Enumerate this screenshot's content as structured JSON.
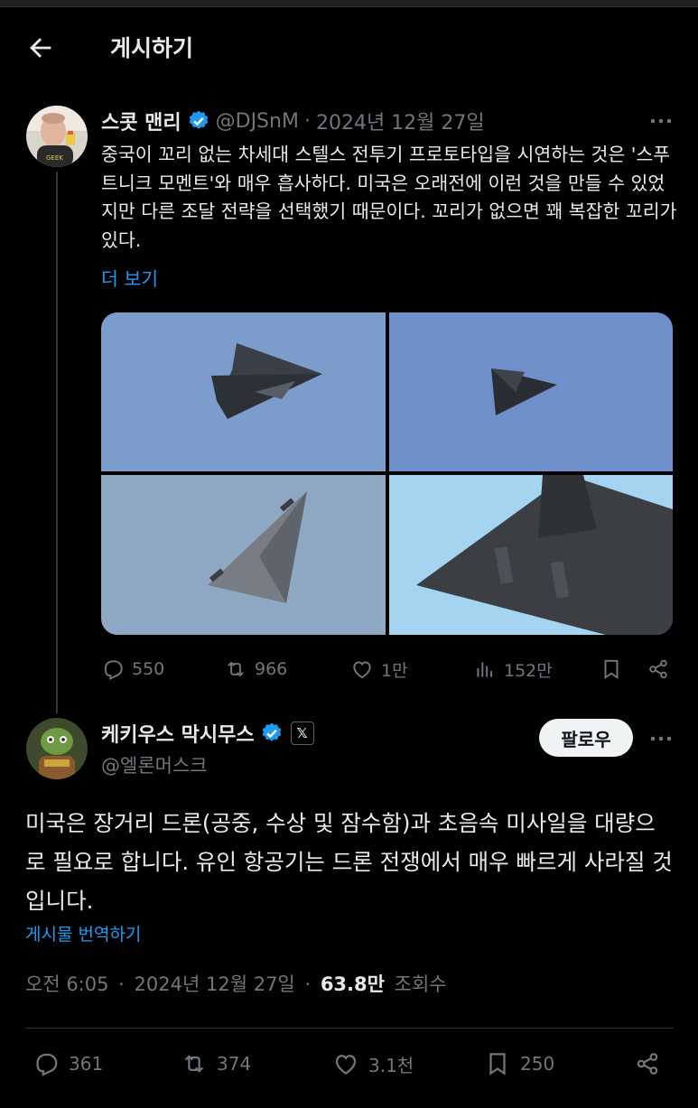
{
  "header": {
    "title": "게시하기"
  },
  "quoted_tweet": {
    "author_name": "스콧 맨리",
    "handle": "@DJSnM",
    "separator": "·",
    "date": "2024년 12월 27일",
    "text": "중국이 꼬리 없는 차세대 스텔스 전투기 프로토타입을 시연하는 것은 '스푸트니크 모멘트'와 매우 흡사하다. 미국은 오래전에 이런 것을 만들 수 있었지만 다른 조달 전략을 선택했기 때문이다. 꼬리가 없으면 꽤 복잡한 꼬리가 있다.",
    "more_link": "더 보기",
    "stats": {
      "replies": "550",
      "reposts": "966",
      "likes": "1만",
      "views": "152만"
    }
  },
  "main_tweet": {
    "author_name": "케키우스 막시무스",
    "x_badge": "𝕏",
    "handle": "@엘론머스크",
    "follow_label": "팔로우",
    "text": "미국은 장거리 드론(공중, 수상 및 잠수함)과 초음속 미사일을 대량으로 필요로 합니다. 유인 항공기는 드론 전쟁에서 매우 빠르게 사라질 것입니다.",
    "translate_link": "게시물 번역하기",
    "time": "오전 6:05",
    "separator": "·",
    "date": "2024년 12월 27일",
    "separator2": "·",
    "views_count": "63.8만",
    "views_label": "조회수",
    "stats": {
      "replies": "361",
      "reposts": "374",
      "likes": "3.1천",
      "bookmarks": "250"
    }
  },
  "colors": {
    "background": "#000000",
    "text": "#e7e9ea",
    "muted": "#71767b",
    "accent": "#1d9bf0",
    "follow_bg": "#eff3f4"
  },
  "icons": [
    "back-arrow-icon",
    "verified-badge-icon",
    "more-icon",
    "reply-icon",
    "repost-icon",
    "like-icon",
    "views-icon",
    "bookmark-icon",
    "share-icon",
    "x-logo-icon"
  ]
}
